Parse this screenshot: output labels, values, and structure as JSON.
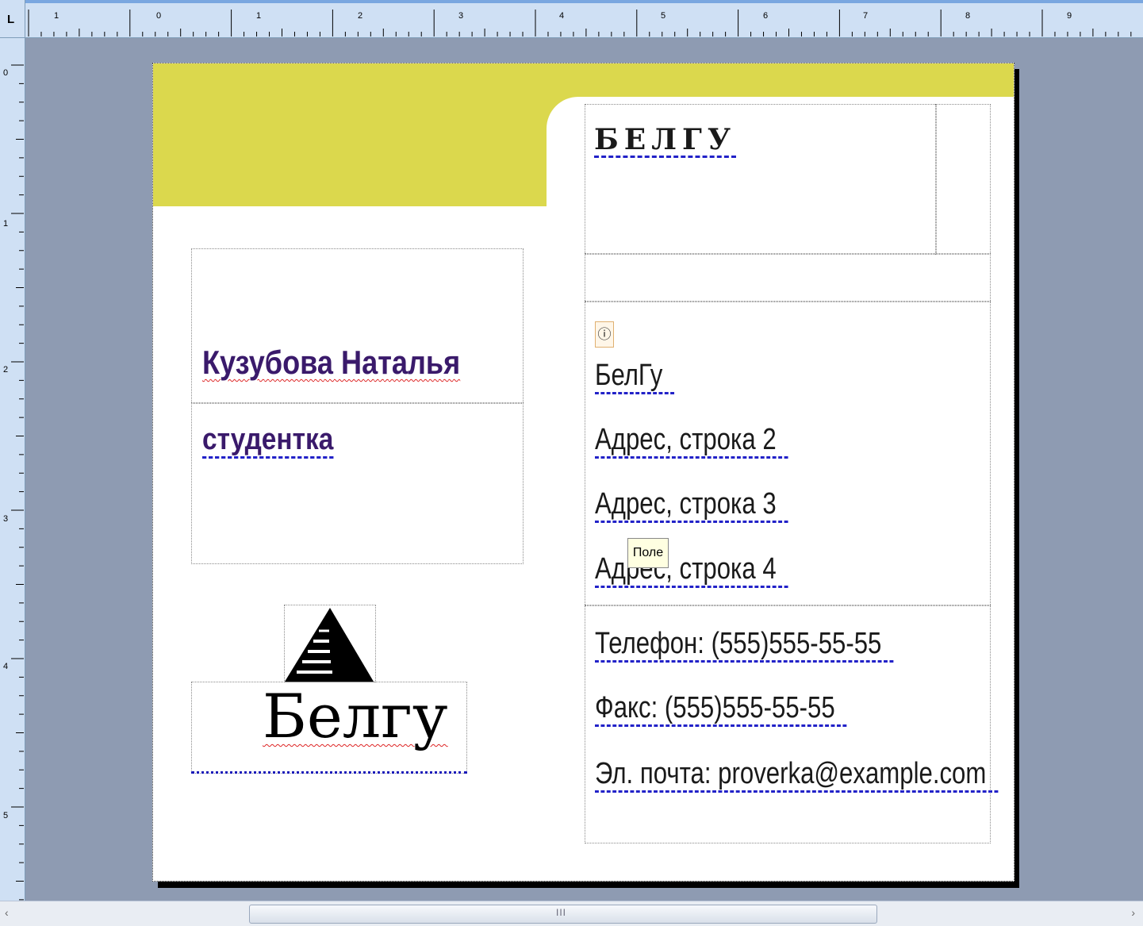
{
  "rulers": {
    "corner_label": "L",
    "horizontal_numbers": [
      "1",
      "0",
      "1",
      "2",
      "3",
      "4",
      "5",
      "6",
      "7",
      "8",
      "9"
    ],
    "vertical_numbers": [
      "0",
      "1",
      "2",
      "3",
      "4",
      "5"
    ]
  },
  "card": {
    "org_title": "БЕЛГУ",
    "name": "Кузубова Наталья",
    "role": "студентка",
    "info_icon": "info-icon",
    "address_lines": [
      "БелГу",
      "Адрес, строка 2",
      "Адрес, строка 3",
      "Адрес, строка 4"
    ],
    "contacts": [
      "Телефон: (555)555-55-55",
      "Факс: (555)555-55-55",
      "Эл. почта: proverka@example.com"
    ],
    "logo_text": "Белгу",
    "logo_icon": "pyramid-logo-icon"
  },
  "tooltip": "Поле",
  "scrollbar": {
    "left_arrow": "‹",
    "right_arrow": "›",
    "grip": "III"
  },
  "colors": {
    "band": "#dbd84d",
    "name": "#3a1a6b",
    "dashed_underline": "#2222c8",
    "background": "#8e9bb2"
  }
}
